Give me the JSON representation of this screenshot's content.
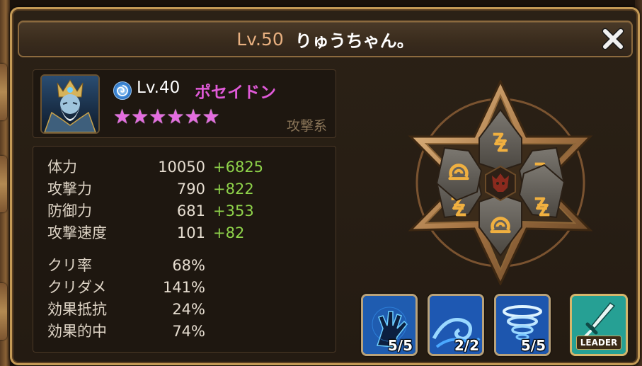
{
  "title": {
    "level": "Lv.50",
    "name": "りゅうちゃん。"
  },
  "monster": {
    "attribute_icon": "water-attribute-icon",
    "level": "Lv.40",
    "name": "ポセイドン",
    "stars": 6,
    "star_glyph": "★",
    "type": "攻撃系"
  },
  "stats": [
    {
      "label": "体力",
      "value": "10050",
      "bonus": "+6825"
    },
    {
      "label": "攻撃力",
      "value": "790",
      "bonus": "+822"
    },
    {
      "label": "防御力",
      "value": "681",
      "bonus": "+353"
    },
    {
      "label": "攻撃速度",
      "value": "101",
      "bonus": "+82"
    },
    {
      "label": "クリ率",
      "value": "68%",
      "bonus": ""
    },
    {
      "label": "クリダメ",
      "value": "141%",
      "bonus": ""
    },
    {
      "label": "効果抵抗",
      "value": "24%",
      "bonus": ""
    },
    {
      "label": "効果的中",
      "value": "74%",
      "bonus": ""
    }
  ],
  "skills": [
    {
      "icon": "claw-hand-skill-icon",
      "count": "5/5"
    },
    {
      "icon": "wave-skill-icon",
      "count": "2/2"
    },
    {
      "icon": "whirlpool-skill-icon",
      "count": "5/5"
    }
  ],
  "leader": {
    "icon": "sword-leader-icon",
    "label": "LEADER"
  },
  "runes": {
    "slots": [
      "energy-rune-icon",
      "energy-rune-icon",
      "energy-rune-icon",
      "energy-rune-icon",
      "guard-rune-icon",
      "guard-rune-icon"
    ]
  },
  "colors": {
    "frame": "#c49a56",
    "level_text": "#e8b080",
    "monster_name": "#e05ad8",
    "bonus": "#8fd34a",
    "rune_plate": "#5a5650",
    "rune_symbol": "#e2a43a"
  }
}
